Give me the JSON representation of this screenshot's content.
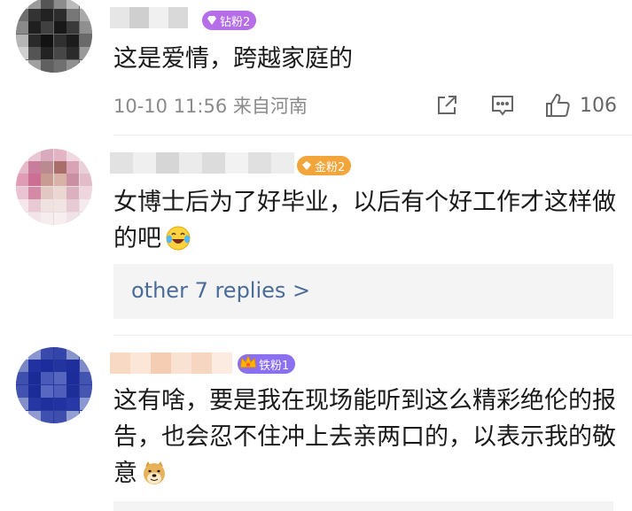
{
  "comments": [
    {
      "username_hidden": true,
      "badge": {
        "label": "钻粉2",
        "color": "#b66ee8",
        "icon": "diamond-icon"
      },
      "text": "这是爱情，跨越家庭的",
      "meta": "10-10 11:56 来自河南",
      "actions": {
        "like_count": "106"
      }
    },
    {
      "username_hidden": true,
      "badge": {
        "label": "金粉2",
        "color": "#f2a53a",
        "icon": "gold-gem-icon"
      },
      "text": "女博士后为了好毕业，以后有个好工作才这样做的吧",
      "emoji": "laughing-tears-emoji",
      "replies_link": "other 7 replies >"
    },
    {
      "username_hidden": true,
      "badge": {
        "label": "铁粉1",
        "color": "#8a6ff0",
        "icon": "crown-icon"
      },
      "text": "这有啥，要是我在现场能听到这么精彩绝伦的报告，也会忍不住冲上去亲两口的，以表示我的敬意",
      "emoji": "doge-emoji"
    }
  ]
}
